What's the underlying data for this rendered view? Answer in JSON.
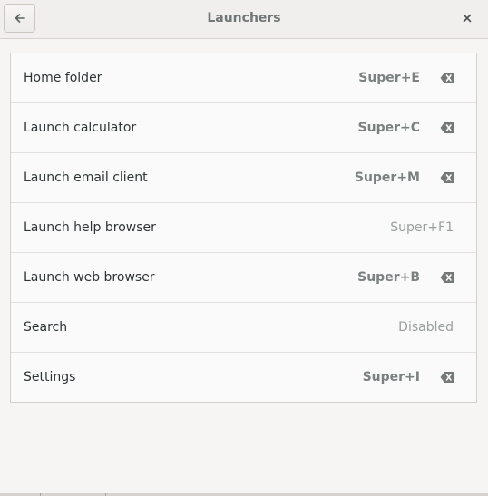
{
  "header": {
    "title": "Launchers"
  },
  "icons": {
    "back": "go-previous-icon",
    "close": "window-close-icon",
    "clear": "edit-clear-icon"
  },
  "shortcuts": [
    {
      "label": "Home folder",
      "accel": "Super+E",
      "clearable": true
    },
    {
      "label": "Launch calculator",
      "accel": "Super+C",
      "clearable": true
    },
    {
      "label": "Launch email client",
      "accel": "Super+M",
      "clearable": true
    },
    {
      "label": "Launch help browser",
      "accel": "Super+F1",
      "clearable": false
    },
    {
      "label": "Launch web browser",
      "accel": "Super+B",
      "clearable": true
    },
    {
      "label": "Search",
      "accel": "Disabled",
      "clearable": false
    },
    {
      "label": "Settings",
      "accel": "Super+I",
      "clearable": true
    }
  ]
}
